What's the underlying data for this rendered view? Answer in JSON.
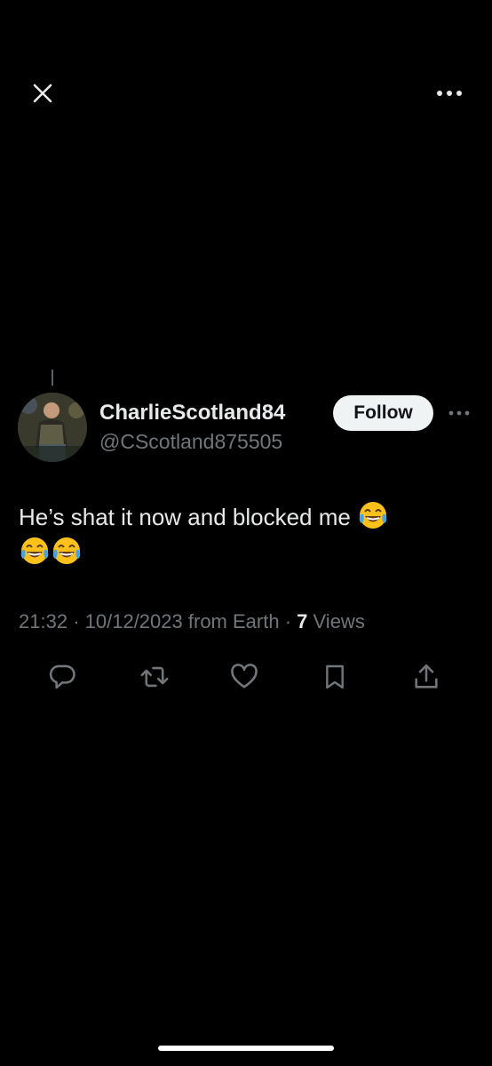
{
  "header": {
    "close_icon": "close-icon",
    "more_icon": "more-horizontal-icon"
  },
  "tweet": {
    "display_name": "CharlieScotland84",
    "handle": "@CScotland875505",
    "follow_label": "Follow",
    "text": "He’s shat it now and blocked me",
    "emoji_count": 3,
    "time": "21:32",
    "date": "10/12/2023",
    "source": "from Earth",
    "views_count": "7",
    "views_label": "Views"
  },
  "actions": [
    {
      "name": "reply",
      "icon": "reply-icon"
    },
    {
      "name": "retweet",
      "icon": "retweet-icon"
    },
    {
      "name": "like",
      "icon": "heart-icon"
    },
    {
      "name": "bookmark",
      "icon": "bookmark-icon"
    },
    {
      "name": "share",
      "icon": "share-icon"
    }
  ],
  "colors": {
    "background": "#000000",
    "primary_text": "#e7e9ea",
    "secondary_text": "#71767b",
    "follow_button_bg": "#eff3f4"
  }
}
